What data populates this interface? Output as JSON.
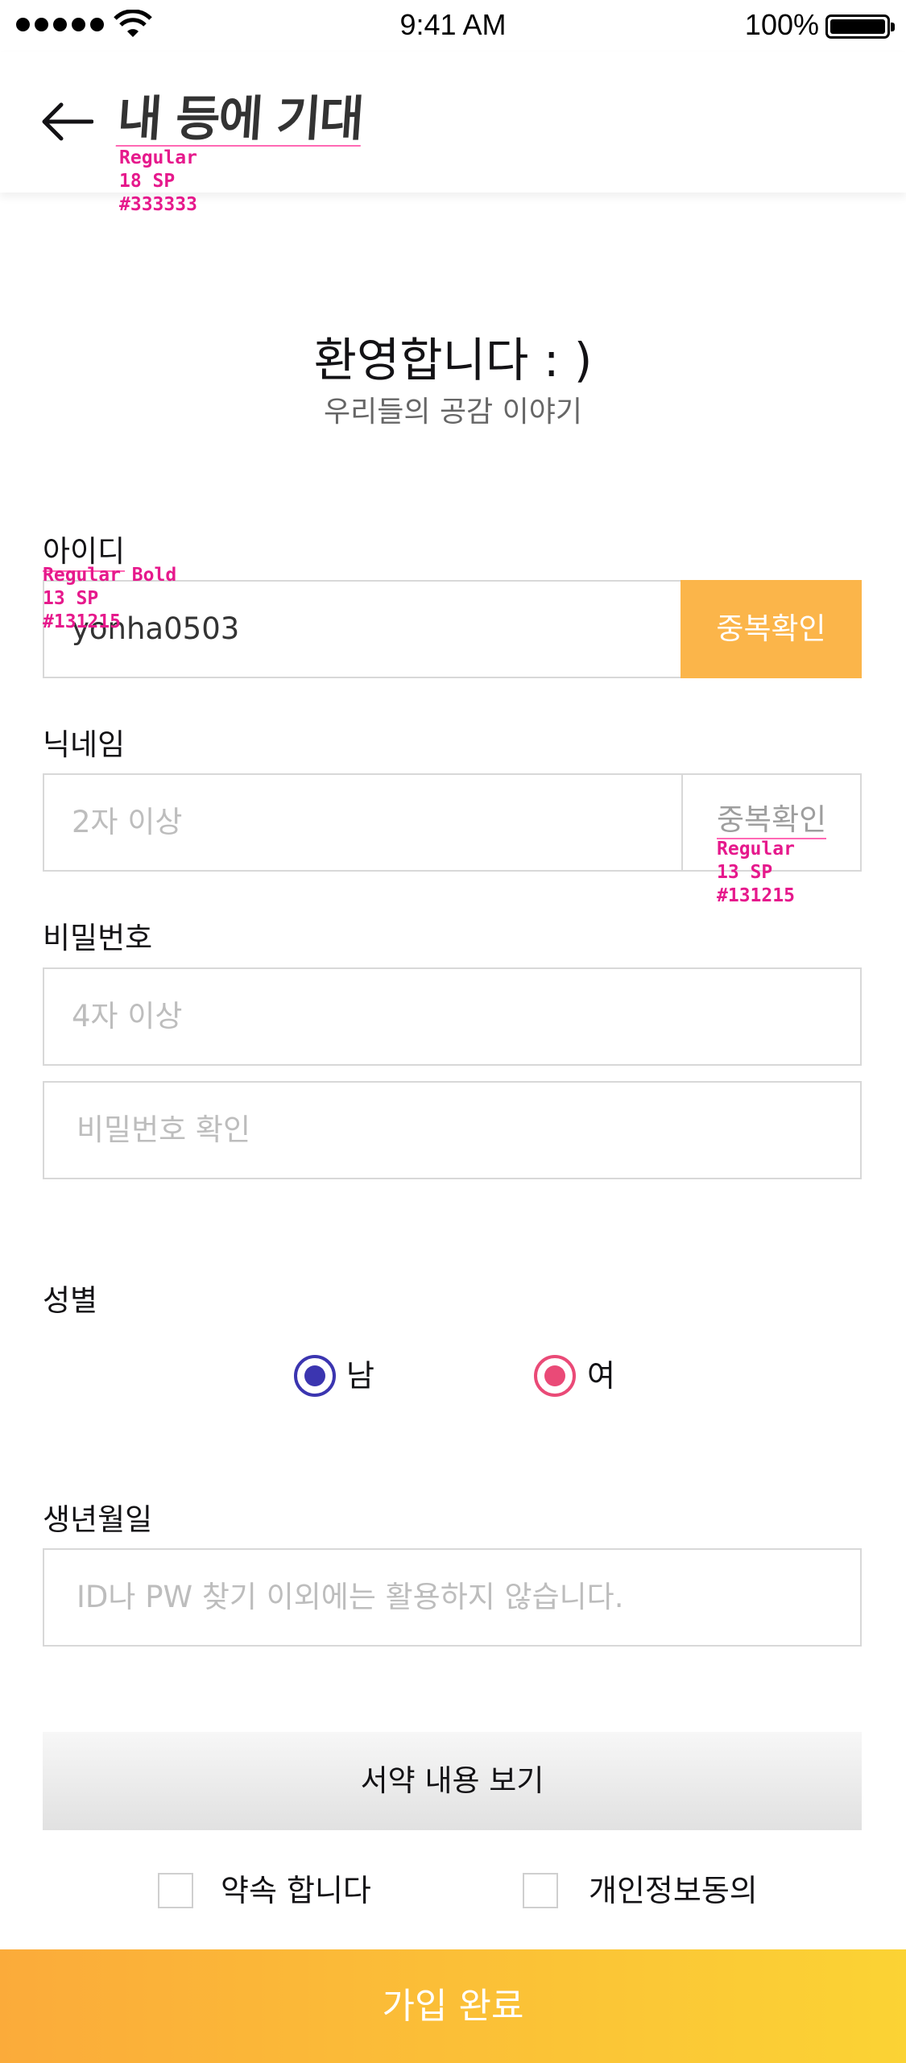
{
  "status_bar": {
    "time": "9:41 AM",
    "battery": "100%"
  },
  "header": {
    "title": "내 등에 기대"
  },
  "annotations": {
    "title": "Regular\n18 SP\n#333333",
    "id_label": "Regular Bold\n13 SP\n#131215",
    "check_button": "Regular\n13 SP\n#131215"
  },
  "welcome": {
    "title": "환영합니다 : )",
    "subtitle": "우리들의 공감 이야기"
  },
  "form": {
    "id": {
      "label": "아이디",
      "value": "yonha0503",
      "check_label": "중복확인"
    },
    "nickname": {
      "label": "닉네임",
      "placeholder": "2자 이상",
      "check_label": "중복확인"
    },
    "password": {
      "label": "비밀번호",
      "placeholder": "4자 이상",
      "confirm_placeholder": "비밀번호 확인"
    },
    "gender": {
      "label": "성별",
      "options": [
        "남",
        "여"
      ],
      "male_color": "#3b35b0",
      "female_color": "#ea4a77"
    },
    "birthdate": {
      "label": "생년월일",
      "placeholder": "ID나 PW 찾기 이외에는 활용하지 않습니다."
    }
  },
  "terms": {
    "button_label": "서약 내용 보기",
    "agree_promise": "약속 합니다",
    "agree_privacy": "개인정보동의"
  },
  "submit": {
    "label": "가입 완료"
  }
}
